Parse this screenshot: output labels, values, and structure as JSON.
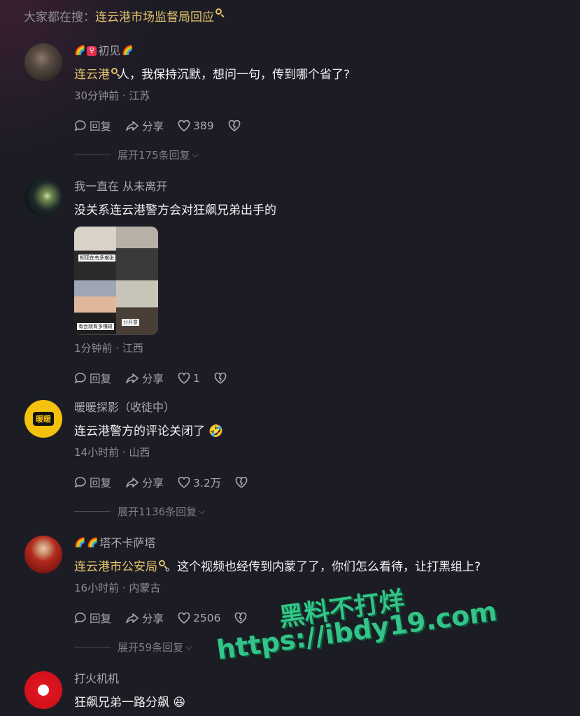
{
  "search": {
    "prefix": "大家都在搜：",
    "term": "连云港市场监督局回应"
  },
  "comments": [
    {
      "name": "初见",
      "text_link": "连云港",
      "text_rest": "人，我保持沉默，想问一句，传到哪个省了?",
      "meta": "30分钟前 · 江苏",
      "reply": "回复",
      "share": "分享",
      "likes": "389",
      "expand": "展开175条回复"
    },
    {
      "name": "我一直在 从未离开",
      "text": "没关系连云港警方会对狂飙兄弟出手的",
      "image_captions": [
        "知现在有多难张",
        "有会就有多懂斑",
        "分开意"
      ],
      "meta": "1分钟前 · 江西",
      "reply": "回复",
      "share": "分享",
      "likes": "1"
    },
    {
      "name": "暖暖探影（收徒中）",
      "avatar_text": "暖暖",
      "text": "连云港警方的评论关闭了",
      "meta": "14小时前 · 山西",
      "reply": "回复",
      "share": "分享",
      "likes": "3.2万",
      "expand": "展开1136条回复"
    },
    {
      "name": "塔不卡萨塔",
      "text_link": "连云港市公安局",
      "text_rest": "。这个视频也经传到内蒙了了，你们怎么看待，让打黑组上?",
      "meta": "16小时前 · 内蒙古",
      "reply": "回复",
      "share": "分享",
      "likes": "2506",
      "expand": "展开59条回复"
    },
    {
      "name": "打火机机",
      "text": "狂飙兄弟一路分飙"
    }
  ],
  "watermark": {
    "line1": "黑料不打烊",
    "line2": "https://ibdy19.com"
  },
  "colors": {
    "background": "#1c1c25",
    "accent": "#e3c36a",
    "watermark": "#34c48a"
  }
}
